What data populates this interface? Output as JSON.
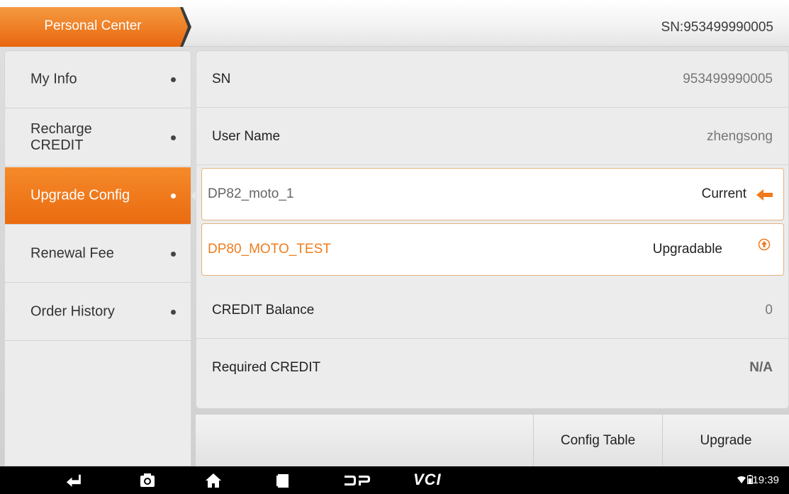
{
  "header": {
    "tab_label": "Personal Center",
    "sn_text": "SN:953499990005"
  },
  "sidebar": {
    "items": [
      {
        "label": "My Info",
        "active": false
      },
      {
        "label": "Recharge CREDIT",
        "active": false
      },
      {
        "label": "Upgrade Config",
        "active": true
      },
      {
        "label": "Renewal Fee",
        "active": false
      },
      {
        "label": "Order History",
        "active": false
      }
    ]
  },
  "info": {
    "sn": {
      "label": "SN",
      "value": "953499990005"
    },
    "user_name": {
      "label": "User Name",
      "value": "zhengsong"
    },
    "credit_balance": {
      "label": "CREDIT Balance",
      "value": "0"
    },
    "required_credit": {
      "label": "Required CREDIT",
      "value": "N/A"
    }
  },
  "configs": [
    {
      "name": "DP82_moto_1",
      "status": "Current",
      "icon": "arrow-left-icon"
    },
    {
      "name": "DP80_MOTO_TEST",
      "status": "Upgradable",
      "icon": "upgrade-circle-icon"
    }
  ],
  "toolbar": {
    "config_table_label": "Config Table",
    "upgrade_label": "Upgrade"
  },
  "statusbar": {
    "time": "19:39",
    "vci_label": "VCI"
  },
  "colors": {
    "accent": "#f07a1c",
    "accent_text": "#ee7d1e"
  }
}
